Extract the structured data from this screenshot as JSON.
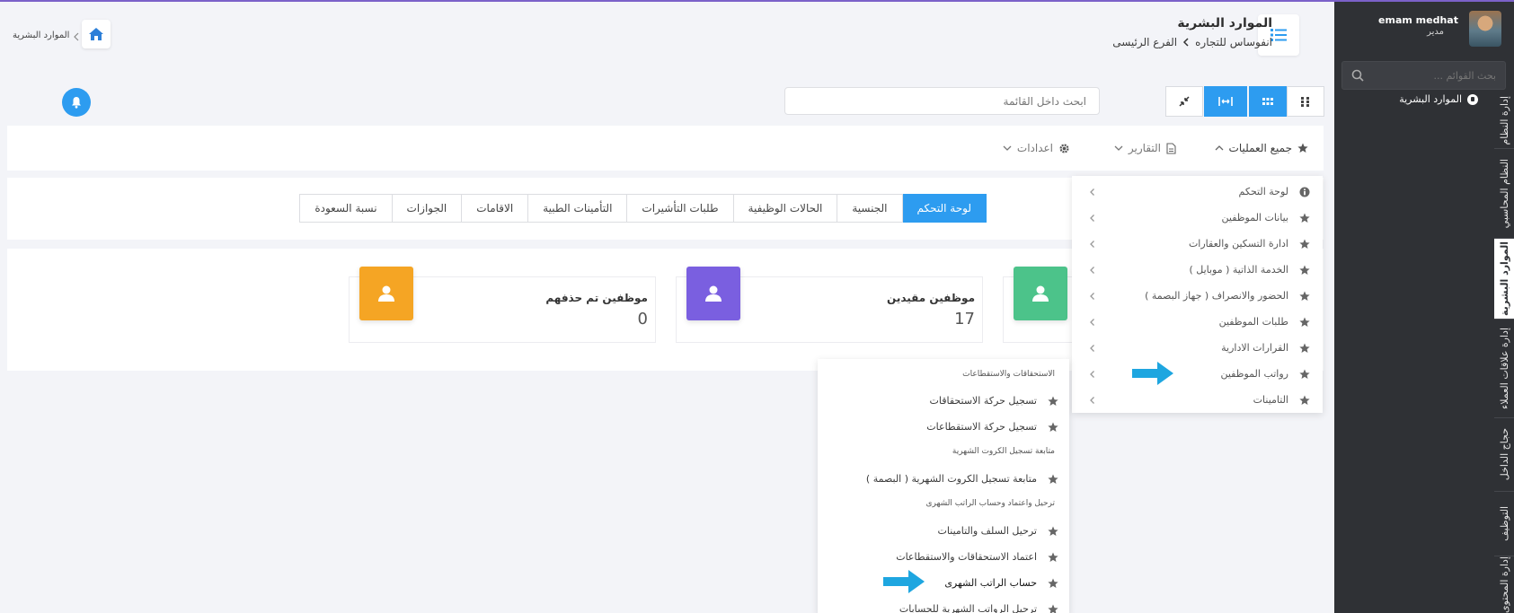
{
  "user": {
    "name": "emam medhat",
    "role": "مدير"
  },
  "sidebar": {
    "search_placeholder": "بحث القوائم ...",
    "active_item": "الموارد البشرية",
    "vertical_tabs": [
      {
        "label": "إدارة النظام",
        "active": false
      },
      {
        "label": "النظام المحاسبي",
        "active": false
      },
      {
        "label": "الموارد البشرية",
        "active": true
      },
      {
        "label": "إدارة علاقات العملاء",
        "active": false
      },
      {
        "label": "حجاج الداخل",
        "active": false
      },
      {
        "label": "التوظيف",
        "active": false
      },
      {
        "label": "إدارة المحتوى",
        "active": false
      }
    ]
  },
  "header": {
    "title": "الموارد البشرية",
    "company": "انفوساس للتجاره",
    "branch": "الفرع الرئيسى",
    "top_breadcrumb": "الموارد البشرية"
  },
  "toolbar": {
    "search_placeholder": "ابحث داخل القائمة"
  },
  "ops": {
    "all_operations": "جميع العمليات",
    "reports": "التقارير",
    "settings": "اعدادات"
  },
  "tabs": [
    "لوحة التحكم",
    "الجنسية",
    "الحالات الوظيفية",
    "طلبات التأشيرات",
    "التأمينات الطبية",
    "الاقامات",
    "الجوازات",
    "نسبة السعودة"
  ],
  "stats": [
    {
      "title": "موظفين مقيدين",
      "value": "17",
      "color": "#7a5fe0"
    },
    {
      "title": "موظفين تم حذفهم",
      "value": "0",
      "color": "#f5a524"
    }
  ],
  "ops_menu": [
    "لوحة التحكم",
    "بيانات الموظفين",
    "ادارة التسكين والعقارات",
    "الخدمة الذاتية ( موبايل )",
    "الحضور والانصراف ( جهاز البصمة )",
    "طلبات الموظفين",
    "القرارات الادارية",
    "رواتب الموظفين",
    "التامينات"
  ],
  "sub_menu": {
    "heading_1": "الاستحقاقات والاستقطاعات",
    "item_1": "تسجيل حركة الاستحقاقات",
    "item_2": "تسجيل حركة الاستقطاعات",
    "heading_2": "متابعة تسجيل الكروت الشهرية",
    "item_3": "متابعة تسجيل الكروت الشهرية ( البصمة )",
    "heading_3": "ترحيل واعتماد وحساب الراتب الشهرى",
    "item_4": "ترحيل السلف والتامينات",
    "item_5": "اعتماد الاستحقاقات والاستقطاعات",
    "item_6": "حساب الراتب الشهرى",
    "item_7": "ترحيل الرواتب الشهرية للحسابات"
  },
  "colors": {
    "accent": "#2d9cf0",
    "arrow": "#1ea6e0",
    "green": "#4cc38a",
    "purple": "#7a5fe0",
    "orange": "#f5a524"
  }
}
